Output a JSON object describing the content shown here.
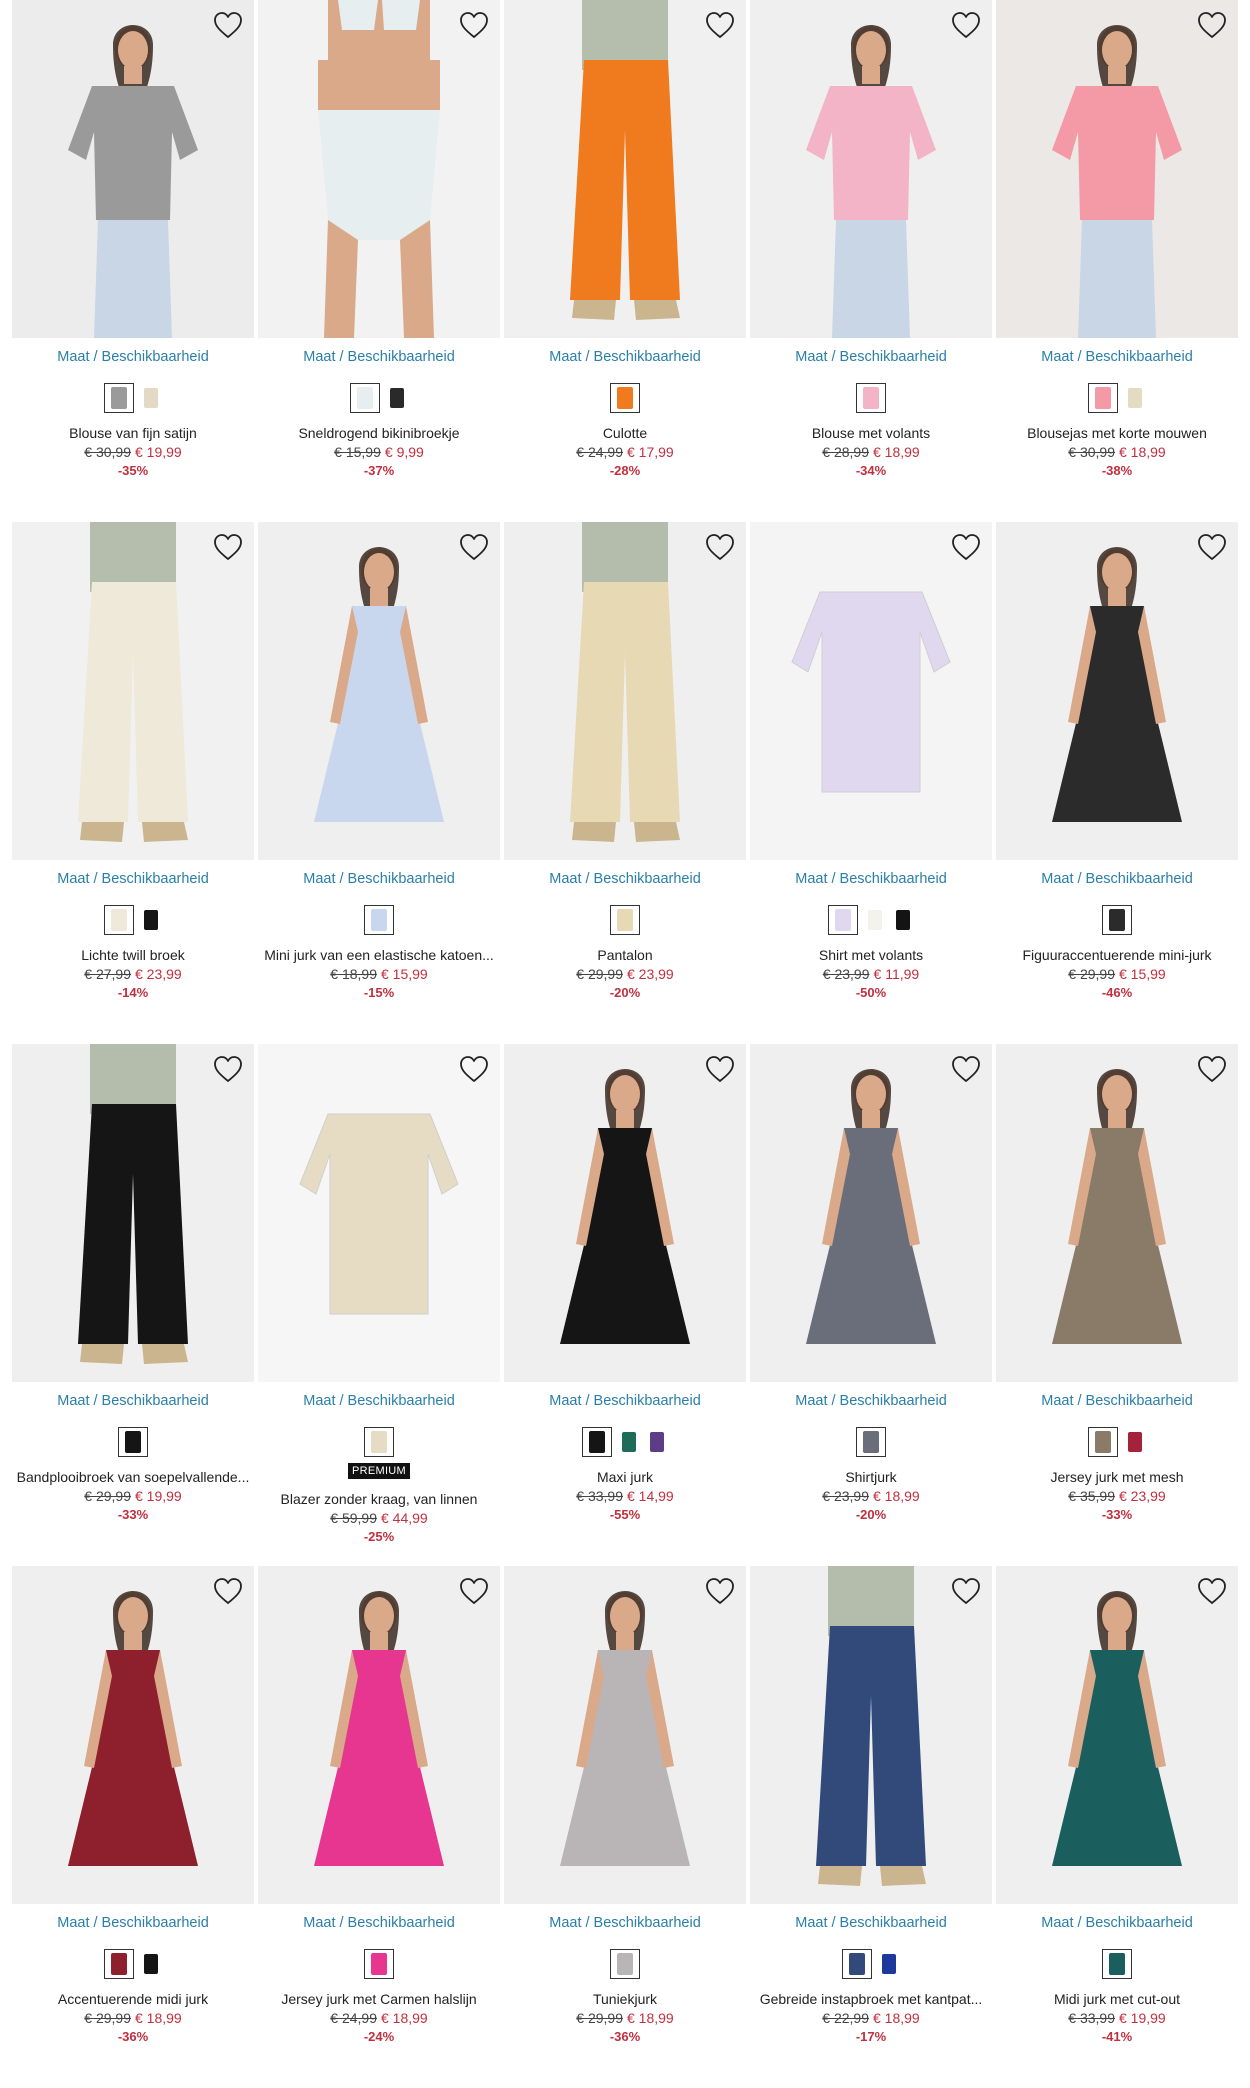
{
  "size_link_label": "Maat / Beschikbaarheid",
  "premium_label": "PREMIUM",
  "products": [
    {
      "name": "Blouse van fijn satijn",
      "old_price": "€ 30,99",
      "new_price": "€ 19,99",
      "discount": "-35%",
      "image": "striped-blouse",
      "bg": "#ececec",
      "swatches": [
        "#9a9a9a",
        "#e3d9c4"
      ]
    },
    {
      "name": "Sneldrogend bikinibroekje",
      "old_price": "€ 15,99",
      "new_price": "€ 9,99",
      "discount": "-37%",
      "image": "floral-bikini-bottom",
      "bg": "#f2f2f2",
      "swatches": [
        "#e7eef0",
        "#2a2a2a"
      ]
    },
    {
      "name": "Culotte",
      "old_price": "€ 24,99",
      "new_price": "€ 17,99",
      "discount": "-28%",
      "image": "orange-culotte",
      "bg": "#f0f0f0",
      "swatches": [
        "#f07a1e"
      ]
    },
    {
      "name": "Blouse met volants",
      "old_price": "€ 28,99",
      "new_price": "€ 18,99",
      "discount": "-34%",
      "image": "pink-ruffle-blouse",
      "bg": "#efefef",
      "swatches": [
        "#f3b4c8"
      ]
    },
    {
      "name": "Blousejas met korte mouwen",
      "old_price": "€ 30,99",
      "new_price": "€ 18,99",
      "discount": "-38%",
      "image": "pink-shirt-jacket",
      "bg": "#ece8e6",
      "swatches": [
        "#f49aa6",
        "#e4dcc2"
      ]
    },
    {
      "name": "Lichte twill broek",
      "old_price": "€ 27,99",
      "new_price": "€ 23,99",
      "discount": "-14%",
      "image": "cream-wide-trousers",
      "bg": "#f1f1f1",
      "swatches": [
        "#eee9d8",
        "#151515"
      ]
    },
    {
      "name": "Mini jurk van een elastische katoen...",
      "old_price": "€ 18,99",
      "new_price": "€ 15,99",
      "discount": "-15%",
      "image": "blue-mini-dress",
      "bg": "#efefef",
      "swatches": [
        "#c8d7ee"
      ]
    },
    {
      "name": "Pantalon",
      "old_price": "€ 29,99",
      "new_price": "€ 23,99",
      "discount": "-20%",
      "image": "beige-pantalon",
      "bg": "#efefef",
      "swatches": [
        "#e8d9b5"
      ]
    },
    {
      "name": "Shirt met volants",
      "old_price": "€ 23,99",
      "new_price": "€ 11,99",
      "discount": "-50%",
      "image": "lilac-ruffle-shirt",
      "bg": "#f4f4f4",
      "swatches": [
        "#e0d8ef",
        "#f4f2ec",
        "#141414"
      ]
    },
    {
      "name": "Figuuraccentuerende mini-jurk",
      "old_price": "€ 29,99",
      "new_price": "€ 15,99",
      "discount": "-46%",
      "image": "check-mini-dress",
      "bg": "#efefef",
      "swatches": [
        "#2b2b2b"
      ]
    },
    {
      "name": "Bandplooibroek van soepelvallende...",
      "old_price": "€ 29,99",
      "new_price": "€ 19,99",
      "discount": "-33%",
      "image": "black-trousers",
      "bg": "#efefef",
      "swatches": [
        "#151515"
      ]
    },
    {
      "name": "Blazer zonder kraag, van linnen",
      "old_price": "€ 59,99",
      "new_price": "€ 44,99",
      "discount": "-25%",
      "image": "linen-blazer",
      "bg": "#f6f6f6",
      "swatches": [
        "#e6dcc3"
      ],
      "premium": true
    },
    {
      "name": "Maxi jurk",
      "old_price": "€ 33,99",
      "new_price": "€ 14,99",
      "discount": "-55%",
      "image": "black-maxi-dress",
      "bg": "#efefef",
      "swatches": [
        "#151515",
        "#1e6b5a",
        "#5d3d86"
      ]
    },
    {
      "name": "Shirtjurk",
      "old_price": "€ 23,99",
      "new_price": "€ 18,99",
      "discount": "-20%",
      "image": "tiedye-dress",
      "bg": "#efefef",
      "swatches": [
        "#6a6e7a"
      ]
    },
    {
      "name": "Jersey jurk met mesh",
      "old_price": "€ 35,99",
      "new_price": "€ 23,99",
      "discount": "-33%",
      "image": "leopard-dress",
      "bg": "#efefef",
      "swatches": [
        "#8a7a68",
        "#a4223a"
      ]
    },
    {
      "name": "Accentuerende midi jurk",
      "old_price": "€ 29,99",
      "new_price": "€ 18,99",
      "discount": "-36%",
      "image": "red-midi-dress",
      "bg": "#efefef",
      "swatches": [
        "#8e1f2d",
        "#151515"
      ]
    },
    {
      "name": "Jersey jurk met Carmen halslijn",
      "old_price": "€ 24,99",
      "new_price": "€ 18,99",
      "discount": "-24%",
      "image": "pink-carmen-dress",
      "bg": "#efefef",
      "swatches": [
        "#e6368f"
      ]
    },
    {
      "name": "Tuniekjurk",
      "old_price": "€ 29,99",
      "new_price": "€ 18,99",
      "discount": "-36%",
      "image": "print-tunic-dress",
      "bg": "#efefef",
      "swatches": [
        "#b9b4b6"
      ]
    },
    {
      "name": "Gebreide instapbroek met kantpat...",
      "old_price": "€ 22,99",
      "new_price": "€ 18,99",
      "discount": "-17%",
      "image": "knit-blue-trousers",
      "bg": "#efefef",
      "swatches": [
        "#324a7a",
        "#1d3a9a"
      ]
    },
    {
      "name": "Midi jurk met cut-out",
      "old_price": "€ 33,99",
      "new_price": "€ 19,99",
      "discount": "-41%",
      "image": "teal-midi-dress",
      "bg": "#efefef",
      "swatches": [
        "#1a5e5e"
      ]
    }
  ]
}
